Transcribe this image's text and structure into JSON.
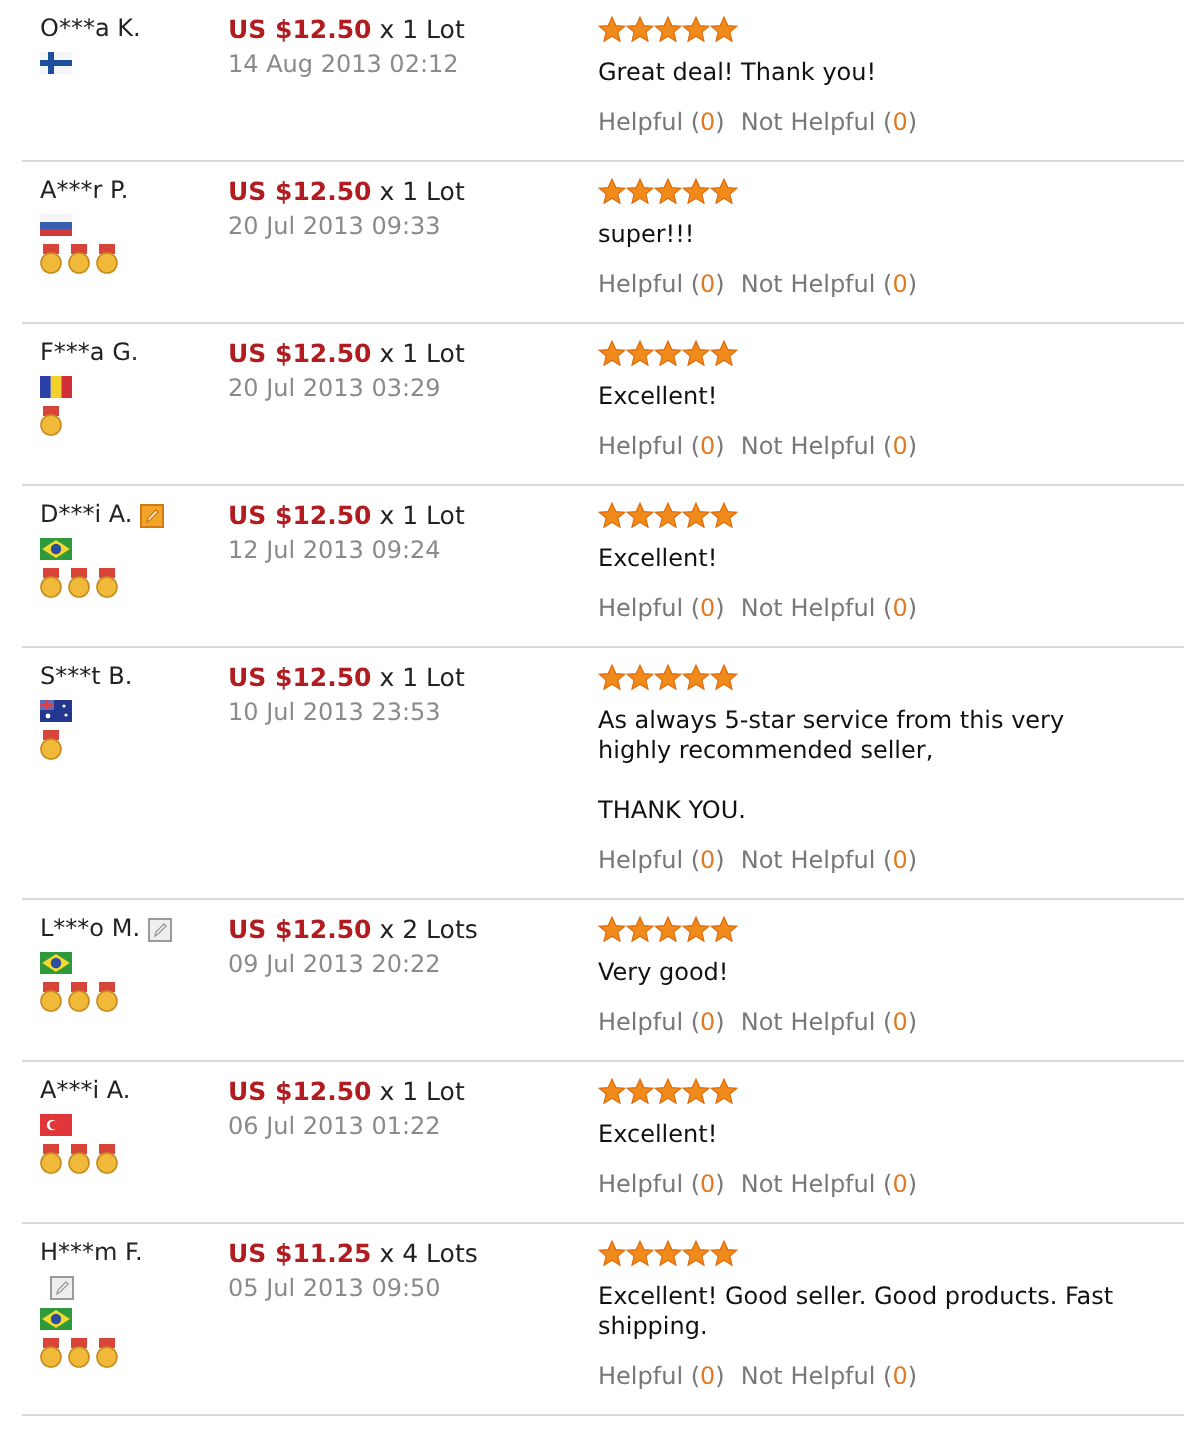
{
  "reviews": [
    {
      "buyer": "O***a K.",
      "flag": {
        "kind": "fi"
      },
      "price": "US $12.50",
      "quantity": "x 1 Lot",
      "date": "14 Aug 2013 02:12",
      "stars": 5,
      "comment": "Great deal! Thank you!",
      "helpful_label": "Helpful",
      "helpful_count": "(0)",
      "not_helpful_label": "Not Helpful",
      "not_helpful_count": "(0)"
    },
    {
      "buyer": "A***r P.",
      "flag": {
        "kind": "ru"
      },
      "medals": [
        {
          "kind": "medal"
        },
        {
          "kind": "medal"
        },
        {
          "kind": "medal"
        }
      ],
      "price": "US $12.50",
      "quantity": "x 1 Lot",
      "date": "20 Jul 2013 09:33",
      "stars": 5,
      "comment": "super!!!",
      "helpful_label": "Helpful",
      "helpful_count": "(0)",
      "not_helpful_label": "Not Helpful",
      "not_helpful_count": "(0)"
    },
    {
      "buyer": "F***a G.",
      "flag": {
        "kind": "ro"
      },
      "medals": [
        {
          "kind": "medal"
        }
      ],
      "price": "US $12.50",
      "quantity": "x 1 Lot",
      "date": "20 Jul 2013 03:29",
      "stars": 5,
      "comment": "Excellent!",
      "helpful_label": "Helpful",
      "helpful_count": "(0)",
      "not_helpful_label": "Not Helpful",
      "not_helpful_count": "(0)"
    },
    {
      "buyer": "D***i A.",
      "edit_badge": {
        "kind": "orange"
      },
      "flag": {
        "kind": "br"
      },
      "medals": [
        {
          "kind": "medal"
        },
        {
          "kind": "medal"
        },
        {
          "kind": "medal"
        }
      ],
      "price": "US $12.50",
      "quantity": "x 1 Lot",
      "date": "12 Jul 2013 09:24",
      "stars": 5,
      "comment": "Excellent!",
      "helpful_label": "Helpful",
      "helpful_count": "(0)",
      "not_helpful_label": "Not Helpful",
      "not_helpful_count": "(0)"
    },
    {
      "buyer": "S***t B.",
      "flag": {
        "kind": "au"
      },
      "medals": [
        {
          "kind": "medal"
        }
      ],
      "price": "US $12.50",
      "quantity": "x 1 Lot",
      "date": "10 Jul 2013 23:53",
      "stars": 5,
      "comment": "As always 5-star service from this very highly recommended seller,\n\nTHANK YOU.",
      "helpful_label": "Helpful",
      "helpful_count": "(0)",
      "not_helpful_label": "Not Helpful",
      "not_helpful_count": "(0)"
    },
    {
      "buyer": "L***o M.",
      "edit_badge": {
        "kind": "gray"
      },
      "flag": {
        "kind": "br"
      },
      "medals": [
        {
          "kind": "medal"
        },
        {
          "kind": "medal"
        },
        {
          "kind": "medal"
        }
      ],
      "price": "US $12.50",
      "quantity": "x 2 Lots",
      "date": "09 Jul 2013 20:22",
      "stars": 5,
      "comment": "Very good!",
      "helpful_label": "Helpful",
      "helpful_count": "(0)",
      "not_helpful_label": "Not Helpful",
      "not_helpful_count": "(0)"
    },
    {
      "buyer": "A***i A.",
      "flag": {
        "kind": "tr"
      },
      "medals": [
        {
          "kind": "medal"
        },
        {
          "kind": "medal"
        },
        {
          "kind": "medal"
        }
      ],
      "price": "US $12.50",
      "quantity": "x 1 Lot",
      "date": "06 Jul 2013 01:22",
      "stars": 5,
      "comment": "Excellent!",
      "helpful_label": "Helpful",
      "helpful_count": "(0)",
      "not_helpful_label": "Not Helpful",
      "not_helpful_count": "(0)"
    },
    {
      "buyer": "H***m F.",
      "edit_badge": {
        "kind": "gray_below"
      },
      "flag": {
        "kind": "br"
      },
      "medals": [
        {
          "kind": "medal"
        },
        {
          "kind": "medal"
        },
        {
          "kind": "medal"
        }
      ],
      "price": "US $11.25",
      "quantity": "x 4 Lots",
      "date": "05 Jul 2013 09:50",
      "stars": 5,
      "comment": "Excellent! Good seller. Good products. Fast shipping.",
      "helpful_label": "Helpful",
      "helpful_count": "(0)",
      "not_helpful_label": "Not Helpful",
      "not_helpful_count": "(0)"
    }
  ]
}
